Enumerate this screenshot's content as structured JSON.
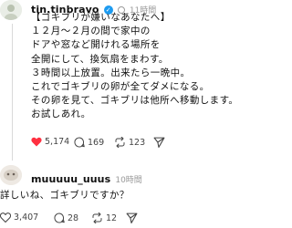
{
  "post": {
    "username": "tin.tinbravo",
    "time": "11時間",
    "lines": [
      "【ゴキブリが嫌いなあなたへ】",
      "１２月〜２月の間で家中の",
      "ドアや窓など開けれる場所を",
      "全開にして、換気扇をまわす。",
      "３時間以上放置。出来たら一晩中。",
      "これでゴキブリの卵が全てダメになる。",
      "その卵を見て、ゴキブリは他所へ移動します。",
      "お試しあれ。"
    ],
    "likes": "5,174",
    "comments": "169",
    "reposts": "123"
  },
  "reply": {
    "username": "muuuuu_uuus",
    "time": "10時間",
    "text": "詳しいね、ゴキブリですか？",
    "likes": "3,407",
    "comments": "28",
    "reposts": "12"
  },
  "colors": {
    "like": "#ff3040",
    "verified": "#1d9bf0",
    "muted": "#9a9a9a"
  }
}
